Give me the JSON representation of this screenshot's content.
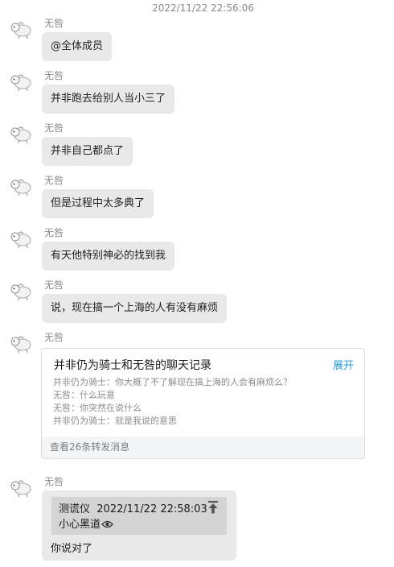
{
  "chat": {
    "timestamp": "2022/11/22 22:56:06",
    "sender_name": "无咎",
    "messages": [
      {
        "text": "@全体成员"
      },
      {
        "text": "并非跑去给别人当小三了"
      },
      {
        "text": "并非自己都点了"
      },
      {
        "text": "但是过程中太多典了"
      },
      {
        "text": "有天他特别神必的找到我"
      },
      {
        "text": "说，现在搞一个上海的人有没有麻烦"
      }
    ],
    "forwarded": {
      "title": "并非仍为骑士和无咎的聊天记录",
      "expand_label": "展开",
      "lines": [
        "并非仍为骑士：你大概了不了解现在搞上海的人会有麻烦么？",
        "无咎：什么玩意",
        "无咎：你突然在说什么",
        "并非仍为骑士：就是我说的意思"
      ],
      "footer": "查看26条转发消息"
    },
    "reply": {
      "quote_sender": "测谎仪",
      "quote_time": "2022/11/22 22:58:03",
      "quote_text": "小心黑道",
      "text": "你说对了"
    }
  },
  "icons": {
    "avatar": "sheep-avatar",
    "jump": "jump-to-original-icon",
    "eye": "eye-icon"
  },
  "colors": {
    "bubble": "#e9e9e9",
    "quote_box": "#d4d4d4",
    "link": "#1ea0d8"
  }
}
